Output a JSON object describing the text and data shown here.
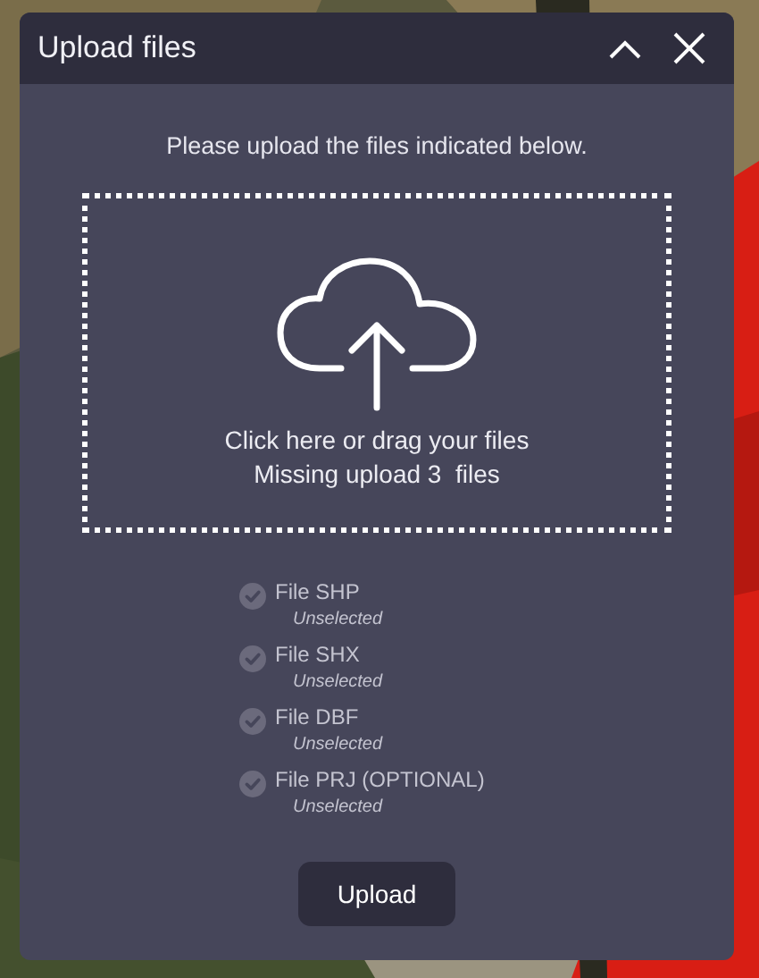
{
  "window": {
    "title": "Upload files"
  },
  "instructions": "Please upload the files indicated below.",
  "dropzone": {
    "prompt": "Click here or drag your files",
    "missing": "Missing upload 3  files"
  },
  "files": [
    {
      "name": "File SHP",
      "status": "Unselected",
      "checked": false
    },
    {
      "name": "File SHX",
      "status": "Unselected",
      "checked": false
    },
    {
      "name": "File DBF",
      "status": "Unselected",
      "checked": false
    },
    {
      "name": "File PRJ (OPTIONAL)",
      "status": "Unselected",
      "checked": false
    }
  ],
  "buttons": [
    "Upload"
  ]
}
